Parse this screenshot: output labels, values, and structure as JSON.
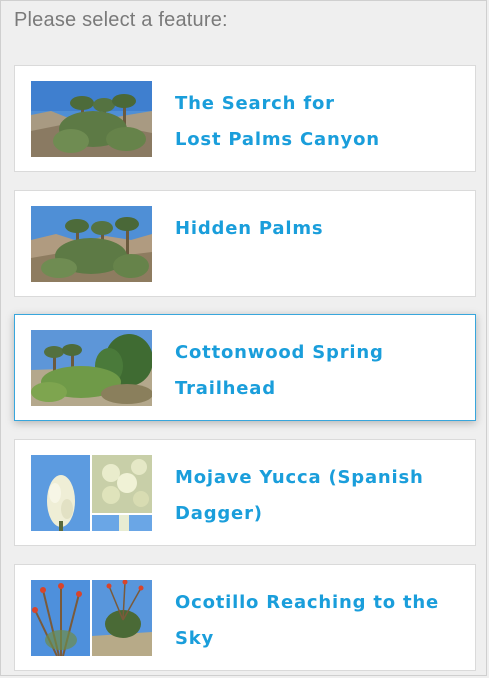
{
  "prompt": "Please select a feature:",
  "features": [
    {
      "label": "The Search for Lost Palms Canyon",
      "line1": "The Search for",
      "line2": "Lost Palms Canyon",
      "thumb": "palms-canyon-photo",
      "selected": false
    },
    {
      "label": "Hidden Palms",
      "line1": "Hidden Palms",
      "line2": "",
      "thumb": "hidden-palms-photo",
      "selected": false
    },
    {
      "label": "Cottonwood Spring Trailhead",
      "line1": "Cottonwood Spring",
      "line2": "Trailhead",
      "thumb": "cottonwood-spring-photo",
      "selected": true
    },
    {
      "label": "Mojave Yucca (Spanish Dagger)",
      "line1": "Mojave Yucca (Spanish",
      "line2": "Dagger)",
      "thumb": "yucca-photo-collage",
      "selected": false
    },
    {
      "label": "Ocotillo Reaching to the Sky",
      "line1": "Ocotillo Reaching to the",
      "line2": "Sky",
      "thumb": "ocotillo-photo-collage",
      "selected": false
    }
  ],
  "colors": {
    "accent": "#1a9edb",
    "selected_border": "#38a6dc",
    "prompt_text": "#7a7a7a",
    "background": "#efefef"
  }
}
